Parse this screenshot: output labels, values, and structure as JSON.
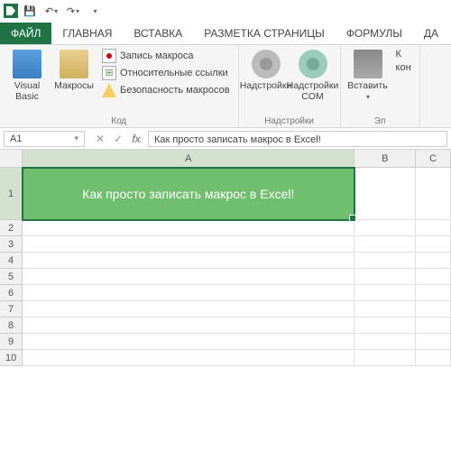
{
  "qat": {
    "save": "💾",
    "undo": "↶",
    "redo": "↷"
  },
  "tabs": {
    "file": "ФАЙЛ",
    "home": "ГЛАВНАЯ",
    "insert": "ВСТАВКА",
    "layout": "РАЗМЕТКА СТРАНИЦЫ",
    "formulas": "ФОРМУЛЫ",
    "data": "ДА"
  },
  "ribbon": {
    "code": {
      "vb": "Visual Basic",
      "macros": "Макросы",
      "record": "Запись макроса",
      "relative": "Относительные ссылки",
      "security": "Безопасность макросов",
      "label": "Код"
    },
    "addins": {
      "addins": "Надстройки",
      "com": "Надстройки COM",
      "label": "Надстройки"
    },
    "controls": {
      "insert": "Вставить",
      "design": "К",
      "design2": "кон",
      "label": "Эл"
    }
  },
  "namebox": "A1",
  "formula": "Как просто записать макрос в Excel!",
  "columns": {
    "a_width": 380,
    "b_width": 70,
    "c_width": 40
  },
  "col_labels": {
    "a": "A",
    "b": "B",
    "c": "C"
  },
  "row_labels": [
    "1",
    "2",
    "3",
    "4",
    "5",
    "6",
    "7",
    "8",
    "9",
    "10"
  ],
  "cell_a1": "Как просто записать макрос в Excel!"
}
